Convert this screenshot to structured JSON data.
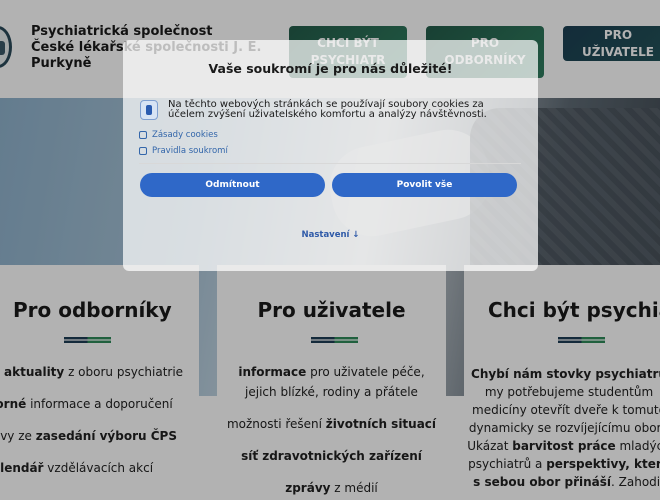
{
  "header": {
    "org_name_lines": [
      "Psychiatrická společnost",
      "České lékařské společnosti J. E.",
      "Purkyně"
    ],
    "nav": [
      {
        "label": "CHCI BÝT PSYCHIATR"
      },
      {
        "label": "PRO ODBORNÍKY"
      },
      {
        "label": "PRO UŽIVATELE"
      }
    ]
  },
  "cards": [
    {
      "title": "Pro odborníky",
      "lines": [
        {
          "bold": "aktuality",
          "text": " z oboru psychiatrie"
        },
        {
          "bold": "odborné",
          "text": " informace a doporučení"
        },
        {
          "pre": "zprávy ze ",
          "bold": "zasedání výboru ČPS",
          "text": ""
        },
        {
          "bold": "kalendář",
          "text": " vzdělávacích akcí"
        }
      ]
    },
    {
      "title": "Pro uživatele",
      "lines": [
        {
          "bold": "informace",
          "text": " pro uživatele péče,"
        },
        {
          "pre": "",
          "bold": "",
          "text": "jejich blízké, rodiny a přátele"
        },
        {
          "pre": "možnosti řešení ",
          "bold": "životních situací",
          "text": ""
        },
        {
          "bold": "síť zdravotnických zařízení",
          "text": ""
        },
        {
          "bold": "zprávy",
          "text": " z médií"
        }
      ]
    },
    {
      "title": "Chci být psychiatr",
      "lines": [
        {
          "bold": "Chybí nám stovky psychiatrů",
          "text": ""
        },
        {
          "text": "my potřebujeme studentům"
        },
        {
          "text": "medicíny otevřít dveře k tomuto"
        },
        {
          "text": "dynamicky se rozvíjejícímu oboru"
        },
        {
          "pre": "Ukázat ",
          "bold": "barvitost práce",
          "text": " mladých"
        },
        {
          "pre": "psychiatrů a ",
          "bold": "perspektivy, které",
          "text": ""
        },
        {
          "pre": "",
          "bold": "s sebou obor přináší",
          "text": ". Zahodit"
        }
      ]
    }
  ],
  "cookie": {
    "title": "Vaše soukromí je pro nás důležité!",
    "text": "Na těchto webových stránkách se používají soubory cookies za účelem zvýšení uživatelského komfortu a analýzy návštěvnosti.",
    "link_cookies": "Zásady cookies",
    "link_privacy": "Pravidla soukromí",
    "decline_label": "Odmítnout",
    "accept_label": "Povolit vše",
    "settings_label": "Nastavení ↓"
  }
}
